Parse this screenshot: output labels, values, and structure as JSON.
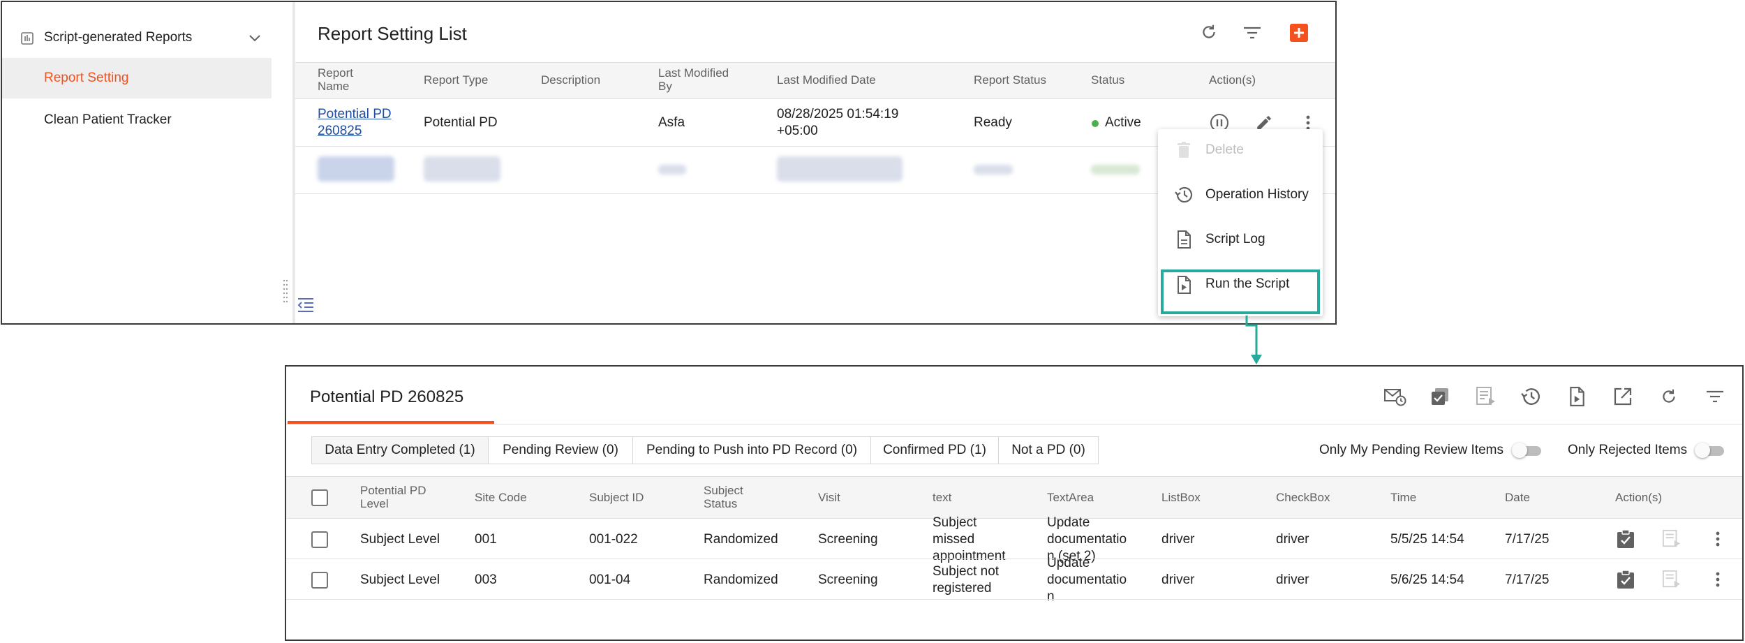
{
  "sidebar": {
    "group_label": "Script-generated Reports",
    "items": [
      {
        "label": "Report Setting",
        "active": true
      },
      {
        "label": "Clean Patient Tracker",
        "active": false
      }
    ]
  },
  "report_list": {
    "title": "Report Setting List",
    "columns": [
      "Report Name",
      "Report Type",
      "Description",
      "Last Modified By",
      "Last Modified Date",
      "Report Status",
      "Status",
      "Action(s)"
    ],
    "column_wrapped": {
      "report_name": [
        "Report",
        "Name"
      ],
      "last_modified_by": [
        "Last Modified",
        "By"
      ]
    },
    "row": {
      "report_name": [
        "Potential PD",
        "260825"
      ],
      "report_type": "Potential PD",
      "description": "",
      "last_modified_by": "Asfa",
      "last_modified_date": [
        "08/28/2025 01:54:19",
        "+05:00"
      ],
      "report_status": "Ready",
      "status": "Active",
      "status_color": "#4caf50"
    }
  },
  "action_menu": {
    "items": [
      {
        "label": "Delete",
        "icon": "trash-icon",
        "disabled": true
      },
      {
        "label": "Operation History",
        "icon": "history-icon",
        "disabled": false
      },
      {
        "label": "Script Log",
        "icon": "document-icon",
        "disabled": false
      },
      {
        "label": "Run the Script",
        "icon": "run-script-icon",
        "disabled": false
      }
    ],
    "highlight_color": "#27a99b"
  },
  "report_detail": {
    "title": "Potential PD 260825",
    "tabs": [
      "Data Entry Completed (1)",
      "Pending Review (0)",
      "Pending to Push into PD Record (0)",
      "Confirmed PD (1)",
      "Not a PD (0)"
    ],
    "toggles": [
      {
        "label": "Only My Pending Review Items",
        "on": false
      },
      {
        "label": "Only Rejected Items",
        "on": false
      }
    ],
    "columns": [
      "Potential PD Level",
      "Site Code",
      "Subject ID",
      "Subject Status",
      "Visit",
      "text",
      "TextArea",
      "ListBox",
      "CheckBox",
      "Time",
      "Date",
      "Action(s)"
    ],
    "column_wrapped": {
      "potential_pd_level": [
        "Potential PD",
        "Level"
      ],
      "subject_status": [
        "Subject",
        "Status"
      ]
    },
    "rows": [
      {
        "level": "Subject Level",
        "site_code": "001",
        "subject_id": "001-022",
        "subject_status": "Randomized",
        "visit": "Screening",
        "text": [
          "Subject",
          "missed",
          "appointment"
        ],
        "textarea": [
          "Update",
          "documentatio",
          "n (set 2)"
        ],
        "listbox": "driver",
        "checkbox": "driver",
        "time": "5/5/25 14:54",
        "date": "7/17/25"
      },
      {
        "level": "Subject Level",
        "site_code": "003",
        "subject_id": "001-04",
        "subject_status": "Randomized",
        "visit": "Screening",
        "text": [
          "Subject not",
          "registered"
        ],
        "textarea": [
          "Update",
          "documentatio",
          "n"
        ],
        "listbox": "driver",
        "checkbox": "driver",
        "time": "5/6/25 14:54",
        "date": "7/17/25"
      }
    ]
  },
  "colors": {
    "accent": "#f4511e",
    "link": "#1f4ea3",
    "active_status": "#4caf50",
    "highlight": "#27a99b"
  }
}
